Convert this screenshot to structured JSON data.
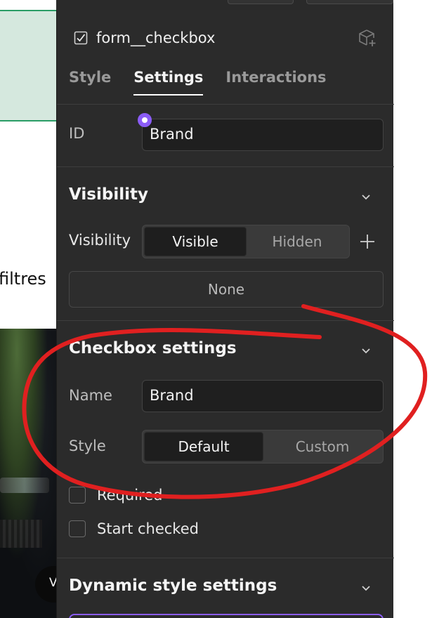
{
  "canvas": {
    "visible_text": "filtres",
    "badge_text": "V"
  },
  "element": {
    "name": "form__checkbox",
    "icon": "checkbox-icon",
    "action_icon": "cube-add-icon"
  },
  "tabs": [
    {
      "label": "Style",
      "active": false
    },
    {
      "label": "Settings",
      "active": true
    },
    {
      "label": "Interactions",
      "active": false
    }
  ],
  "id_field": {
    "label": "ID",
    "value": "Brand"
  },
  "visibility_section": {
    "title": "Visibility",
    "row_label": "Visibility",
    "options": [
      "Visible",
      "Hidden"
    ],
    "selected": "Visible",
    "condition_value": "None"
  },
  "checkbox_settings": {
    "title": "Checkbox settings",
    "name_label": "Name",
    "name_value": "Brand",
    "style_label": "Style",
    "style_options": [
      "Default",
      "Custom"
    ],
    "style_selected": "Default",
    "required_label": "Required",
    "required_checked": false,
    "start_checked_label": "Start checked",
    "start_checked_checked": false
  },
  "dynamic_style": {
    "title": "Dynamic style settings"
  },
  "colors": {
    "panel_bg": "#2b2b2b",
    "accent_purple": "#8b5cf6",
    "annotation_red": "#e02020",
    "canvas_green": "#d5e8de"
  }
}
